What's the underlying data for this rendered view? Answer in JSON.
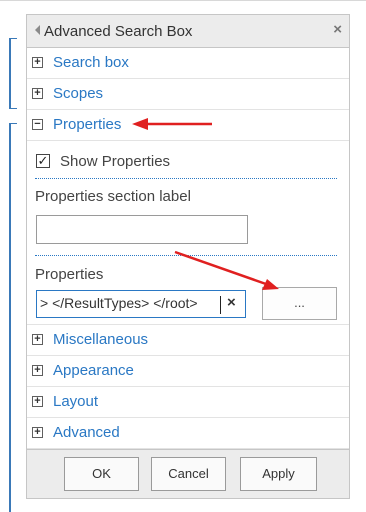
{
  "panel": {
    "title": "Advanced Search Box",
    "close_glyph": "×",
    "collapse_glyph": "◂"
  },
  "sections": {
    "search_box": {
      "label": "Search box",
      "state": "+"
    },
    "scopes": {
      "label": "Scopes",
      "state": "+"
    },
    "properties": {
      "label": "Properties",
      "state": "−"
    },
    "miscellaneous": {
      "label": "Miscellaneous",
      "state": "+"
    },
    "appearance": {
      "label": "Appearance",
      "state": "+"
    },
    "layout": {
      "label": "Layout",
      "state": "+"
    },
    "advanced": {
      "label": "Advanced",
      "state": "+"
    }
  },
  "properties_panel": {
    "show_properties": {
      "label": "Show Properties",
      "checked": true,
      "glyph": "✓"
    },
    "section_label": {
      "label": "Properties section label",
      "value": ""
    },
    "properties": {
      "label": "Properties",
      "value": ">    </ResultTypes> </root>",
      "clear_glyph": "×"
    },
    "browse_button": "..."
  },
  "footer": {
    "ok": "OK",
    "cancel": "Cancel",
    "apply": "Apply"
  },
  "annotation_color": "#e02020"
}
